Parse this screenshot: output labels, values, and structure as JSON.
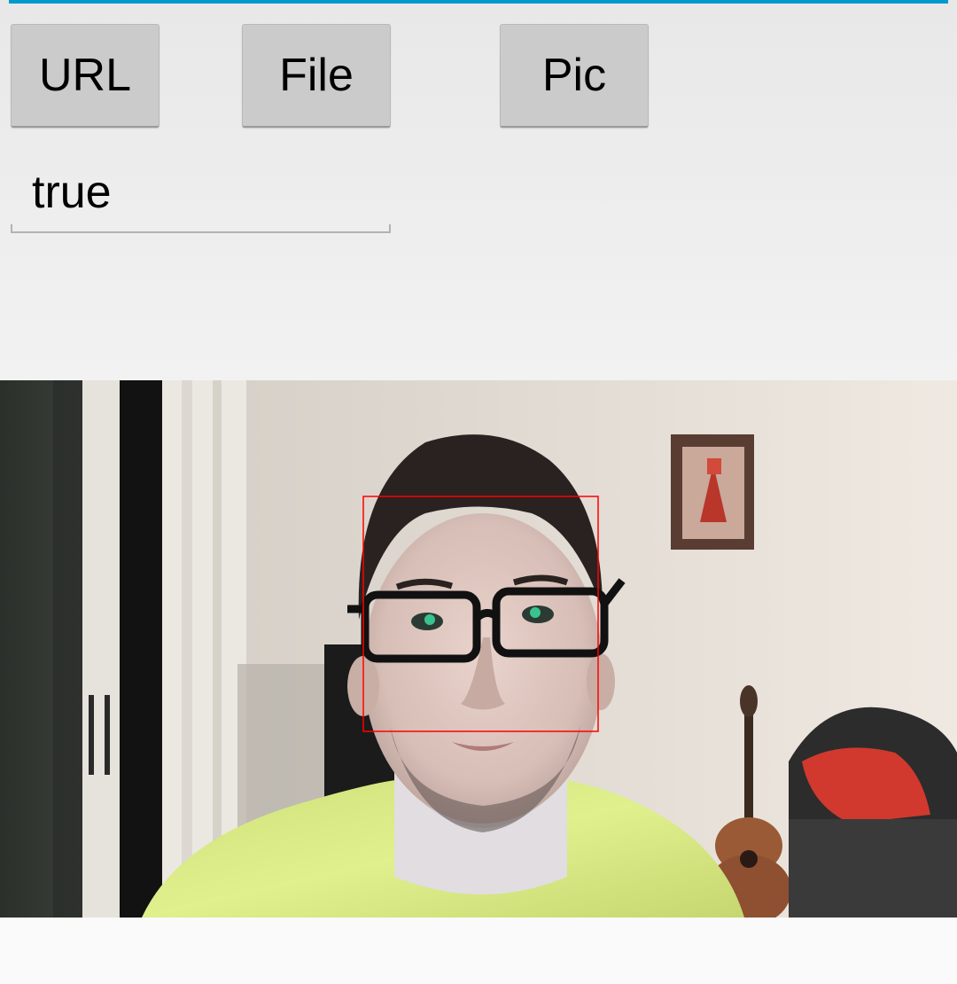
{
  "buttons": {
    "url_label": "URL",
    "file_label": "File",
    "pic_label": "Pic"
  },
  "result_field": {
    "value": "true"
  },
  "colors": {
    "accent": "#0099cc",
    "face_box": "#ff0000",
    "button_bg": "#cbcbcb",
    "background": "#f0f0f0"
  },
  "image": {
    "subject": "person-with-glasses",
    "face_detected": true
  }
}
